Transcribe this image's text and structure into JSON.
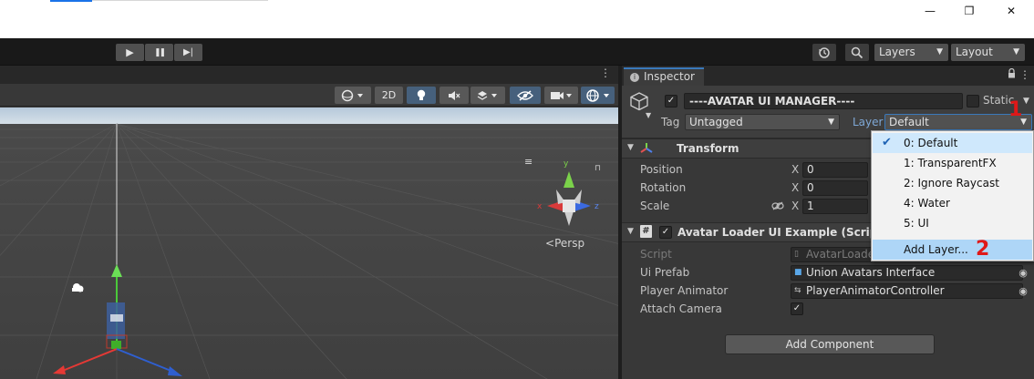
{
  "window": {
    "minimize_glyph": "—",
    "maximize_glyph": "❐",
    "close_glyph": "✕"
  },
  "toolbar": {
    "play_glyph": "▶",
    "pause_glyph": "❚❚",
    "step_glyph": "▶|",
    "history_icon": "history-icon",
    "search_icon": "search-icon",
    "layers_label": "Layers",
    "layout_label": "Layout"
  },
  "scene": {
    "kebab_glyph": "⋮",
    "tools": {
      "draw_mode_icon": "shading-sphere-icon",
      "twod_label": "2D",
      "lighting_icon": "lightbulb-icon",
      "audio_icon": "audio-muted-icon",
      "effects_icon": "effects-icon",
      "visibility_icon": "eye-hidden-icon",
      "camera_icon": "camera-icon",
      "gizmos_icon": "gizmos-icon"
    },
    "gizmo_axes": {
      "y": "y",
      "x": "x",
      "z": "z"
    },
    "persp_label": "Persp",
    "persp_glyph": "<",
    "hamburger_glyph": "≡"
  },
  "inspector": {
    "tab_label": "Inspector",
    "lock_glyph": "🔒",
    "kebab_glyph": "⋮",
    "gameobject": {
      "active_checked": true,
      "name": "----AVATAR UI MANAGER----",
      "static_label": "Static",
      "tag_label": "Tag",
      "tag_value": "Untagged",
      "layer_label": "Layer",
      "layer_value": "Default"
    },
    "transform": {
      "title": "Transform",
      "rows": [
        {
          "label": "Position",
          "axis": "X",
          "value": "0"
        },
        {
          "label": "Rotation",
          "axis": "X",
          "value": "0"
        },
        {
          "label": "Scale",
          "axis": "X",
          "value": "1"
        }
      ]
    },
    "script_component": {
      "title": "Avatar Loader UI Example (Script)",
      "hash_glyph": "#",
      "enabled": true,
      "script_label": "Script",
      "script_value": "AvatarLoade",
      "ui_prefab_label": "Ui Prefab",
      "ui_prefab_value": "Union Avatars Interface",
      "player_animator_label": "Player Animator",
      "player_animator_value": "PlayerAnimatorController",
      "attach_camera_label": "Attach Camera",
      "attach_camera_checked": true
    },
    "add_component_label": "Add Component"
  },
  "layer_popup": {
    "items": [
      {
        "label": "0: Default",
        "checked": true
      },
      {
        "label": "1: TransparentFX",
        "checked": false
      },
      {
        "label": "2: Ignore Raycast",
        "checked": false
      },
      {
        "label": "4: Water",
        "checked": false
      },
      {
        "label": "5: UI",
        "checked": false
      }
    ],
    "add_layer_label": "Add Layer..."
  },
  "annotations": {
    "first": "1",
    "second": "2"
  },
  "colors": {
    "accent_blue": "#3a79bb",
    "annotation_red": "#e01818",
    "popup_selection": "#cfe8fc",
    "popup_hover": "#aed6f7"
  }
}
